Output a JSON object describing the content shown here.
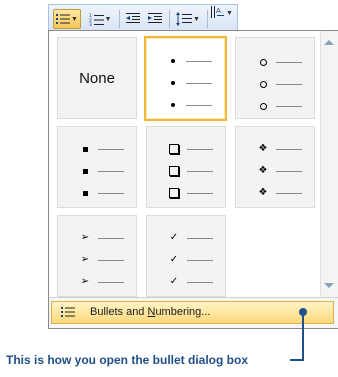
{
  "toolbar": {
    "buttons": [
      {
        "name": "bullets-icon",
        "active": true
      },
      {
        "name": "numbering-icon",
        "active": false
      },
      {
        "name": "decrease-indent-icon",
        "active": false
      },
      {
        "name": "increase-indent-icon",
        "active": false
      },
      {
        "name": "line-spacing-icon",
        "active": false
      },
      {
        "name": "sort-icon",
        "active": false
      }
    ]
  },
  "gallery": {
    "none_label": "None",
    "items": [
      {
        "label": "None",
        "marker": null,
        "selected": false
      },
      {
        "label": "Small filled dot",
        "marker": "dot-fill",
        "selected": true
      },
      {
        "label": "Hollow circle",
        "marker": "dot-open",
        "selected": false
      },
      {
        "label": "Filled square",
        "marker": "sq-fill",
        "selected": false
      },
      {
        "label": "Hollow square",
        "marker": "sq-open",
        "selected": false
      },
      {
        "label": "Four diamonds",
        "marker": "❖",
        "selected": false
      },
      {
        "label": "Arrowhead",
        "marker": "➢",
        "selected": false
      },
      {
        "label": "Check mark",
        "marker": "✓",
        "selected": false
      }
    ]
  },
  "footer": {
    "bullets_and_numbering_label_pre": "Bullets and ",
    "bullets_and_numbering_label_hot": "N",
    "bullets_and_numbering_label_post": "umbering..."
  },
  "caption": "This is how you open the bullet dialog box"
}
